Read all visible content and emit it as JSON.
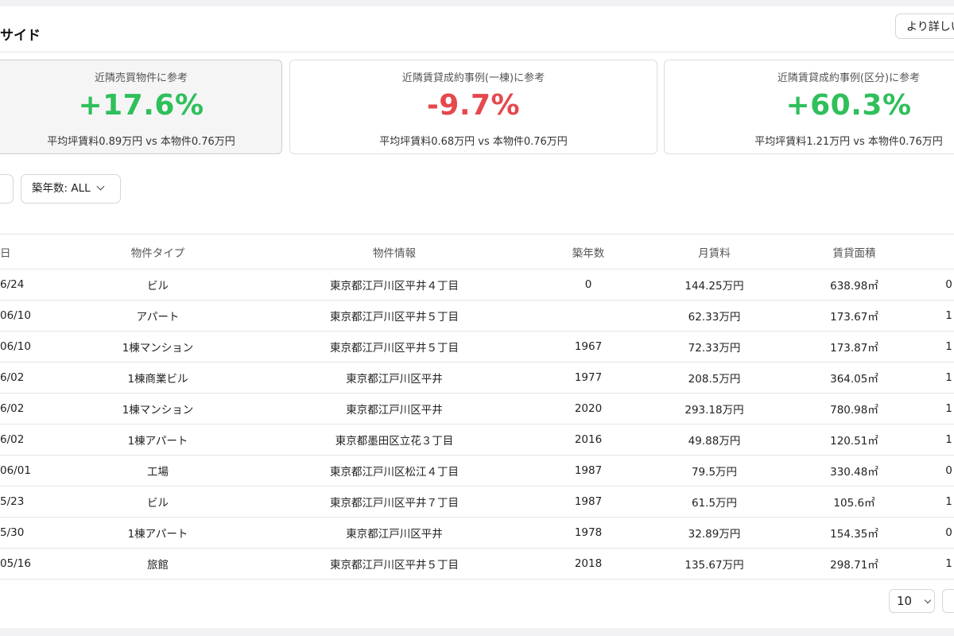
{
  "header": {
    "title": "サイド",
    "more_label": "より詳しい"
  },
  "stats": [
    {
      "label": "近隣売買物件に参考",
      "value": "+17.6%",
      "sub": "平均坪賃料0.89万円 vs 本物件0.76万円",
      "trend": "positive"
    },
    {
      "label": "近隣賃貸成約事例(一棟)に参考",
      "value": "-9.7%",
      "sub": "平均坪賃料0.68万円 vs 本物件0.76万円",
      "trend": "negative"
    },
    {
      "label": "近隣賃貸成約事例(区分)に参考",
      "value": "+60.3%",
      "sub": "平均坪賃料1.21万円 vs 本物件0.76万円",
      "trend": "positive"
    }
  ],
  "filters": {
    "building_age": "築年数: ALL"
  },
  "table": {
    "columns": [
      "日",
      "物件タイプ",
      "物件情報",
      "築年数",
      "月賃料",
      "賃貸面積",
      ""
    ],
    "rows": [
      [
        "6/24",
        "ビル",
        "東京都江戸川区平井４丁目",
        "0",
        "144.25万円",
        "638.98㎡",
        "0"
      ],
      [
        "06/10",
        "アパート",
        "東京都江戸川区平井５丁目",
        "",
        "62.33万円",
        "173.67㎡",
        "1"
      ],
      [
        "06/10",
        "1棟マンション",
        "東京都江戸川区平井５丁目",
        "1967",
        "72.33万円",
        "173.87㎡",
        "1"
      ],
      [
        "6/02",
        "1棟商業ビル",
        "東京都江戸川区平井",
        "1977",
        "208.5万円",
        "364.05㎡",
        "1"
      ],
      [
        "6/02",
        "1棟マンション",
        "東京都江戸川区平井",
        "2020",
        "293.18万円",
        "780.98㎡",
        "1"
      ],
      [
        "6/02",
        "1棟アパート",
        "東京都墨田区立花３丁目",
        "2016",
        "49.88万円",
        "120.51㎡",
        "1"
      ],
      [
        "06/01",
        "工場",
        "東京都江戸川区松江４丁目",
        "1987",
        "79.5万円",
        "330.48㎡",
        "0"
      ],
      [
        "5/23",
        "ビル",
        "東京都江戸川区平井７丁目",
        "1987",
        "61.5万円",
        "105.6㎡",
        "1"
      ],
      [
        "5/30",
        "1棟アパート",
        "東京都江戸川区平井",
        "1978",
        "32.89万円",
        "154.35㎡",
        "0"
      ],
      [
        "05/16",
        "旅館",
        "東京都江戸川区平井５丁目",
        "2018",
        "135.67万円",
        "298.71㎡",
        "1"
      ]
    ]
  },
  "pagination": {
    "page_size": "10"
  },
  "colors": {
    "positive": "#2fbf5b",
    "negative": "#e5484d"
  }
}
